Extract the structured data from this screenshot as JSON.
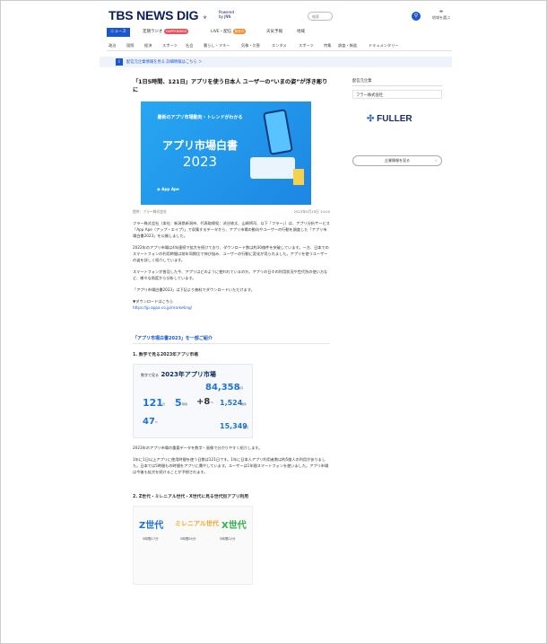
{
  "header": {
    "logo": "TBS NEWS DIG",
    "logo_sub_1": "Powered",
    "logo_sub_2": "by JNN",
    "search_placeholder": "検索",
    "location_label": "地域を選ぶ"
  },
  "tabs": [
    {
      "label": "ニュース",
      "active": true
    },
    {
      "label": "定期ラジオ",
      "badge": "HAPPENINGS"
    },
    {
      "label": "LIVE・配信",
      "badge": "配信中"
    },
    {
      "label": "天気予報"
    },
    {
      "label": "地域"
    }
  ],
  "subnav": [
    "政治",
    "国際",
    "経済",
    "スポーツ",
    "社会",
    "暮らし・マネー",
    "気象・災害",
    "エンタメ",
    "スポーツ",
    "特集",
    "調査・報道",
    "ドキュメンタリー"
  ],
  "breadcrumb_bar": {
    "icon": "i",
    "text": "配信元企業情報を見る 詳細情報はこちら ＞"
  },
  "article": {
    "title": "「1日5時間、121日」アプリを使う日本人 ユーザーの“いまの姿”が浮き彫りに",
    "hero": {
      "subtitle": "最新のアプリ市場動向・トレンドがわかる",
      "title": "アプリ市場白書",
      "year": "2023",
      "brand": "App Ape"
    },
    "caption_left": "提供：フラー株式会社",
    "caption_right": "2023年5月19日 10:00",
    "paragraphs": [
      "フラー株式会社（本社：新潟県新潟市、代表取締役：渋谷修太、山崎将司、以下「フラー」）は、アプリ分析サービス「App Ape（アップ・エイプ）」で収集するデータから、アプリ市場の動向やユーザーの行動を調査した「アプリ市場白書2023」を公開しました。",
      "2022年のアプリ市場は4年連続で拡大を続けており、ダウンロード数は約30億件を突破しています。一方、日本でのスマートフォンの利用時間は前年同期比で伸び悩み、ユーザーの行動に変化が見られました。アプリを使うユーザーの姿を詳しく紹介しています。",
      "スマートフォンが普及した今、アプリはどのように使われているのか。アプリの日々の利用状況や世代別の使い方など、様々な角度から分析しています。",
      "「アプリ市場白書2023」は下記より無料でダウンロードいただけます。"
    ],
    "download_label": "▼ダウンロードはこちら",
    "download_link": "https://jp.appa.co.jp/marketing/",
    "section_title": "「アプリ市場白書2023」を一部ご紹介",
    "sub1": "1. 数字で見る2023年アプリ市場",
    "infographic": {
      "pre": "数字で見る",
      "title": "2023年アプリ市場",
      "stats": [
        "84,358",
        "121",
        "5",
        "+8",
        "1,524",
        "47",
        "15,349"
      ],
      "units": [
        "億円",
        "日",
        "時間",
        "%",
        "億件",
        "%",
        "億円"
      ]
    },
    "body2": [
      "2023年のアプリ市場の重要データを数字・画像で分かりやすく紹介します。",
      "1年に1日以上アプリに使用時間を使う日数は121日です。1年に日本人アプリ利用者数は約5億人の利用がありました。日本では5時間もの時間をアプリに費やしています。ユーザーは1年間スマートフォンを使いました。アプリ市場は今後も拡大を続けることが予想されます。"
    ],
    "sub2": "2. Z世代・ミレニアル世代・X世代に見る世代別アプリ利用",
    "generations": [
      {
        "label": "Z世代",
        "color": "#1d6fd8"
      },
      {
        "label": "ミレニアル世代",
        "color": "#f5a623"
      },
      {
        "label": "X世代",
        "color": "#2fb344"
      }
    ],
    "gen_values": [
      "5時間17分",
      "5時間45分",
      "5時間22分"
    ]
  },
  "sidebar": {
    "label": "配信元企業",
    "company": "フラー株式会社",
    "logo_text": "FULLER",
    "button": "企業情報を見る"
  }
}
